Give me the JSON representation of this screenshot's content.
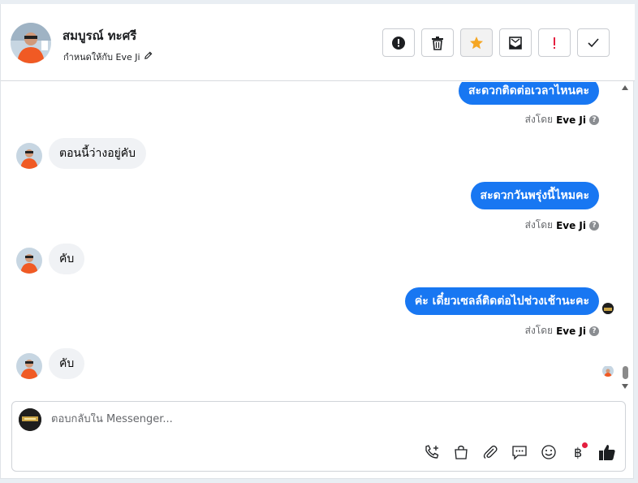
{
  "header": {
    "name": "สมบูรณ์ ทะศรี",
    "assigned_to": "กำหนดให้กับ Eve Ji",
    "toolbar": [
      {
        "name": "report-button",
        "icon": "alert-circle-icon"
      },
      {
        "name": "delete-button",
        "icon": "trash-icon"
      },
      {
        "name": "star-button",
        "icon": "star-icon"
      },
      {
        "name": "mark-unread-button",
        "icon": "envelope-icon"
      },
      {
        "name": "important-button",
        "icon": "exclamation-icon"
      },
      {
        "name": "done-button",
        "icon": "check-icon"
      }
    ]
  },
  "messages": [
    {
      "dir": "out",
      "text": "สะดวกติดต่อเวลาไหนคะ",
      "sent_by_label": "ส่งโดย",
      "sender": "Eve Ji"
    },
    {
      "dir": "in",
      "text": "ตอนนี้ว่างอยู่คับ"
    },
    {
      "dir": "out",
      "text": "สะดวกวันพรุ่งนี้ไหมคะ",
      "sent_by_label": "ส่งโดย",
      "sender": "Eve Ji"
    },
    {
      "dir": "in",
      "text": "คับ"
    },
    {
      "dir": "out",
      "text": "ค่ะ เดี๋ยวเซลล์ติดต่อไปช่วงเช้านะคะ",
      "sent_by_label": "ส่งโดย",
      "sender": "Eve Ji"
    },
    {
      "dir": "in",
      "text": "คับ"
    }
  ],
  "composer": {
    "placeholder": "ตอบกลับใน Messenger..."
  },
  "colors": {
    "accent": "#1877f2",
    "star": "#f5a623",
    "danger": "#e41e3f"
  }
}
